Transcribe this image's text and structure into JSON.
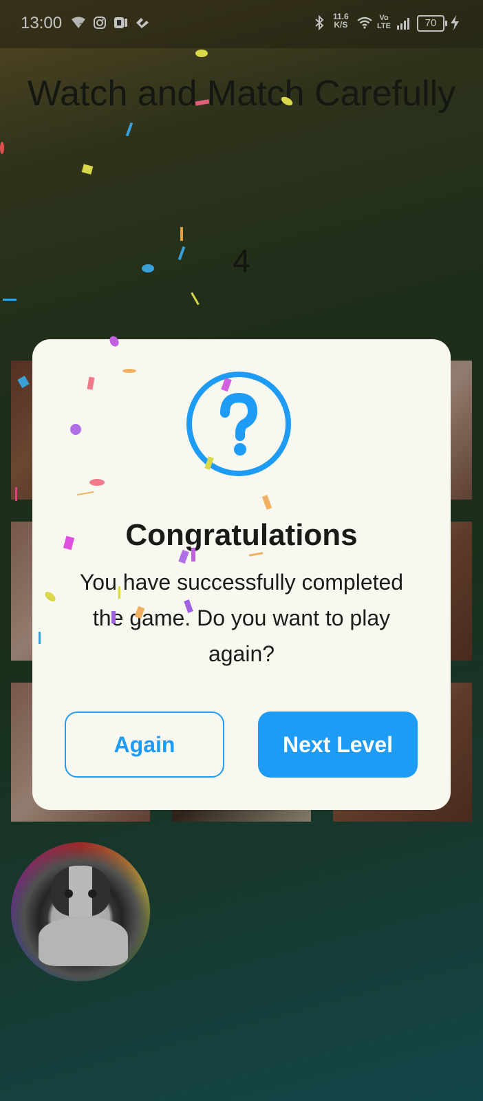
{
  "status_bar": {
    "time": "13:00",
    "speed_value": "11.6",
    "speed_unit": "K/S",
    "network_top": "Vo",
    "network_bottom": "LTE",
    "battery": "70",
    "icons": [
      "wifi-question-icon",
      "instagram-icon",
      "app-icon",
      "app-icon-2",
      "bluetooth-icon",
      "wifi-icon",
      "signal-icon",
      "battery-icon",
      "charging-icon"
    ]
  },
  "game": {
    "title": "Watch and Match Carefully",
    "counter": "4"
  },
  "dialog": {
    "icon": "help-circle-icon",
    "title": "Congratulations",
    "message": "You have successfully completed the game. Do you want to play again?",
    "again_label": "Again",
    "next_label": "Next Level"
  },
  "colors": {
    "accent": "#1e9bf5",
    "dialog_bg": "#f8f8f0",
    "title_text": "#1a1a16"
  }
}
